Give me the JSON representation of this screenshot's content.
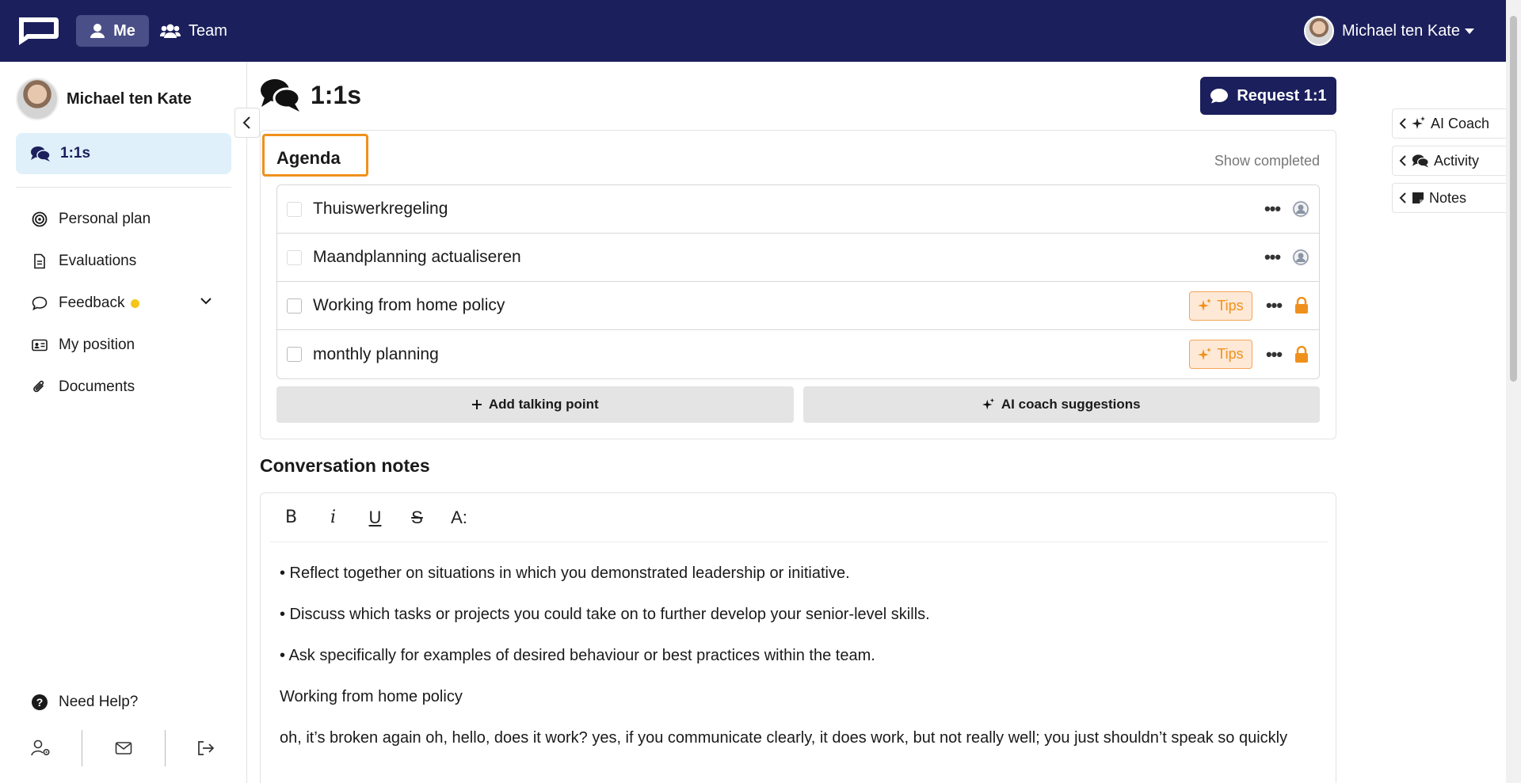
{
  "topbar": {
    "nav_me": "Me",
    "nav_team": "Team",
    "user_name": "Michael ten Kate"
  },
  "sidebar": {
    "profile_name": "Michael ten Kate",
    "active_item": "1:1s",
    "items": [
      {
        "label": "Personal plan",
        "icon": "target-icon"
      },
      {
        "label": "Evaluations",
        "icon": "document-icon"
      },
      {
        "label": "Feedback",
        "icon": "chat-bubble-icon"
      },
      {
        "label": "My position",
        "icon": "id-card-icon"
      },
      {
        "label": "Documents",
        "icon": "paperclip-icon"
      }
    ],
    "need_help": "Need Help?"
  },
  "main": {
    "title": "1:1s",
    "request_button": "Request 1:1",
    "agenda": {
      "title": "Agenda",
      "show_completed": "Show completed",
      "items": [
        {
          "label": "Thuiswerkregeling",
          "tips": false,
          "private": false
        },
        {
          "label": "Maandplanning actualiseren",
          "tips": false,
          "private": false
        },
        {
          "label": "Working from home policy",
          "tips": true,
          "private": true
        },
        {
          "label": "monthly planning",
          "tips": true,
          "private": true
        }
      ],
      "tips_label": "Tips",
      "add_talking_point": "Add talking point",
      "ai_coach_suggestions": "AI coach suggestions"
    },
    "conversation_notes": {
      "title": "Conversation notes",
      "toolbar": [
        "B",
        "i",
        "U",
        "S",
        "A:"
      ],
      "paragraphs": [
        "• Reflect together on situations  in which you demonstrated leadership or initiative.",
        "• Discuss  which tasks or projects you  could take on to further develop your senior-level skills.",
        "• Ask specifically for examples  of desired behaviour or best  practices within the team.",
        "Working from home policy",
        "oh, it’s broken again oh, hello, does it work? yes, if you communicate clearly, it does work, but not really well; you just shouldn’t speak so quickly"
      ]
    }
  },
  "right_panel": {
    "tabs": [
      "AI Coach",
      "Activity",
      "Notes"
    ]
  },
  "colors": {
    "navy": "#1b1f5c",
    "accent_orange": "#f0901c",
    "active_bg": "#e0f0fb",
    "notification_dot": "#f5c518"
  }
}
